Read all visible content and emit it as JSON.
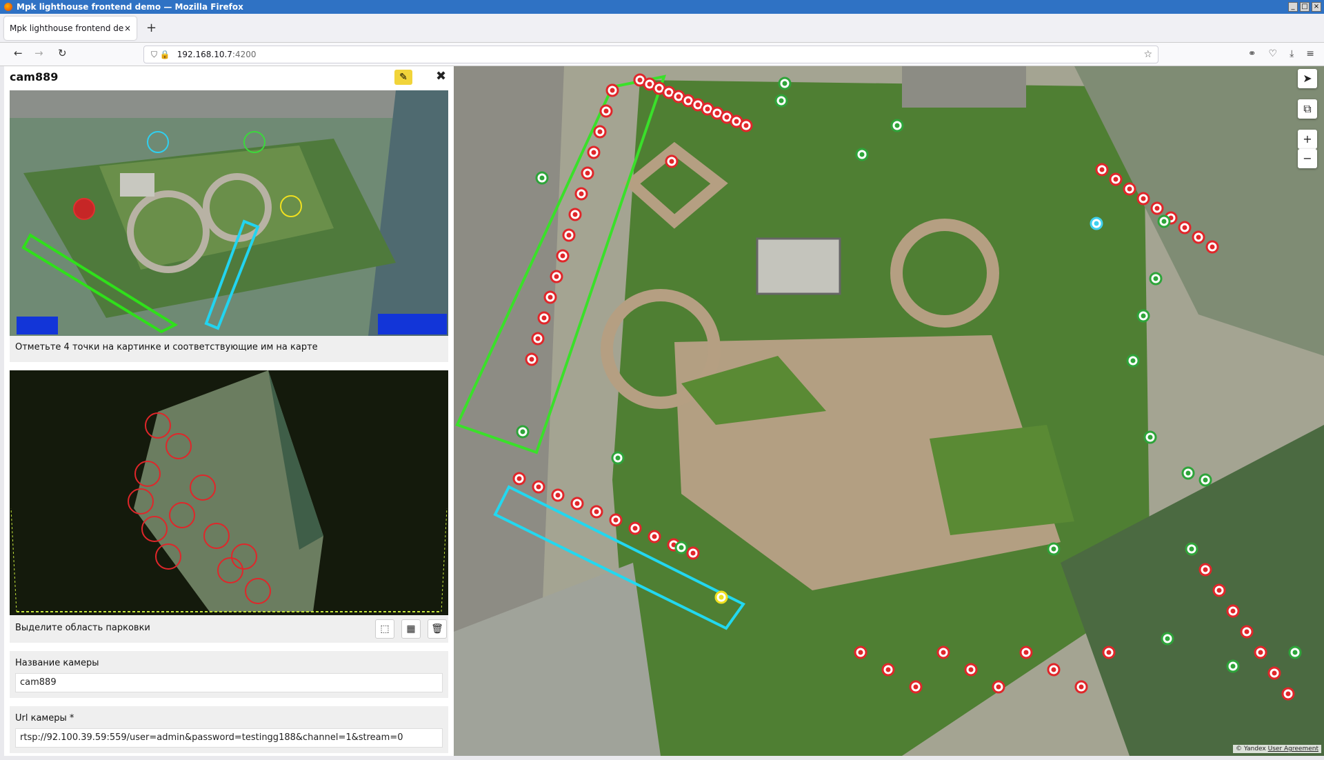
{
  "window": {
    "title": "Mpk lighthouse frontend demo — Mozilla Firefox",
    "controls": [
      "_",
      "□",
      "×"
    ]
  },
  "tabs": [
    {
      "label": "Mpk lighthouse frontend demo",
      "close": "×"
    }
  ],
  "newtab": "+",
  "nav": {
    "back": "←",
    "forward": "→",
    "reload": "↻",
    "url_host": "192.168.10.7",
    "url_port": ":4200",
    "lock_icons": "⛉ 🔒",
    "star": "☆",
    "right_icons": [
      "⚭",
      "♡",
      "⤓",
      "≡"
    ]
  },
  "panel": {
    "title": "cam889",
    "edit_icon": "✎",
    "close_icon": "✖",
    "image_caption": "Отметьте 4 точки на картинке и соответствующие им на карте",
    "parking_label": "Выделите область парковки",
    "tools": [
      "⬚",
      "▦",
      "🗑"
    ],
    "camera_name_label": "Название камеры",
    "camera_name_value": "cam889",
    "url_label": "Url камеры *",
    "url_value": "rtsp://92.100.39.59:559/user=admin&password=testingg188&channel=1&stream=0"
  },
  "map": {
    "controls": [
      "➤",
      "⧉",
      "+",
      "−"
    ],
    "attribution_brand": "© Yandex",
    "attribution_link": "User Agreement",
    "colors": {
      "occupied": "#e0262a",
      "free": "#2ea43a",
      "green_zone": "#33cc22",
      "cyan_zone": "#22c4e0",
      "yellow_point": "#f0e020",
      "cyan_point": "#3fd0ef"
    }
  }
}
